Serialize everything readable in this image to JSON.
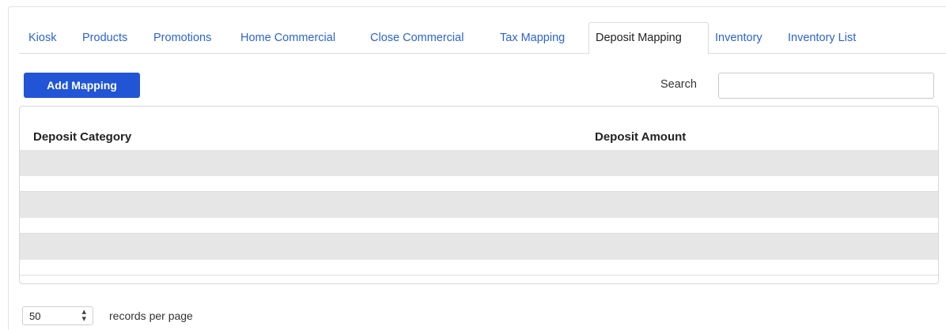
{
  "tabs": [
    {
      "label": "Kiosk",
      "active": false
    },
    {
      "label": "Products",
      "active": false
    },
    {
      "label": "Promotions",
      "active": false
    },
    {
      "label": "Home Commercial",
      "active": false
    },
    {
      "label": "Close Commercial",
      "active": false
    },
    {
      "label": "Tax Mapping",
      "active": false
    },
    {
      "label": "Deposit Mapping",
      "active": true
    },
    {
      "label": "Inventory",
      "active": false
    },
    {
      "label": "Inventory List",
      "active": false
    }
  ],
  "toolbar": {
    "add_label": "Add Mapping",
    "search_label": "Search",
    "search_value": ""
  },
  "table": {
    "columns": [
      "Deposit Category",
      "Deposit Amount"
    ],
    "rows": []
  },
  "footer": {
    "page_size": "50",
    "records_label": "records per page"
  },
  "colors": {
    "accent": "#2155d6",
    "link": "#2b62d9",
    "row_shade": "#e6e6e6"
  }
}
